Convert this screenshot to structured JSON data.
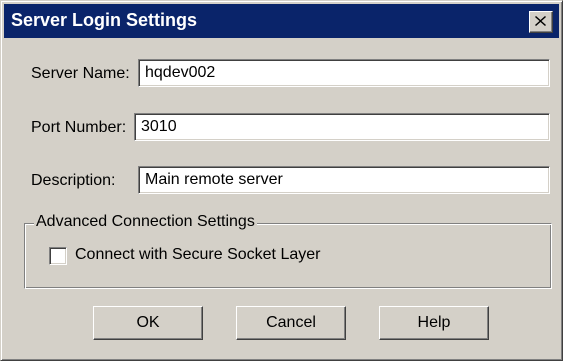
{
  "window": {
    "title": "Server Login Settings",
    "close_icon": "close-icon"
  },
  "form": {
    "server_name": {
      "label": "Server Name:",
      "value": "hqdev002"
    },
    "port_number": {
      "label": "Port Number:",
      "value": "3010"
    },
    "description": {
      "label": "Description:",
      "value": "Main remote server"
    }
  },
  "advanced": {
    "title": "Advanced Connection Settings",
    "secure_socket": {
      "label": "Connect with Secure Socket Layer",
      "checked": false
    }
  },
  "buttons": {
    "ok": "OK",
    "cancel": "Cancel",
    "help": "Help"
  },
  "colors": {
    "titlebar": "#0a246a",
    "face": "#d4d0c8"
  }
}
